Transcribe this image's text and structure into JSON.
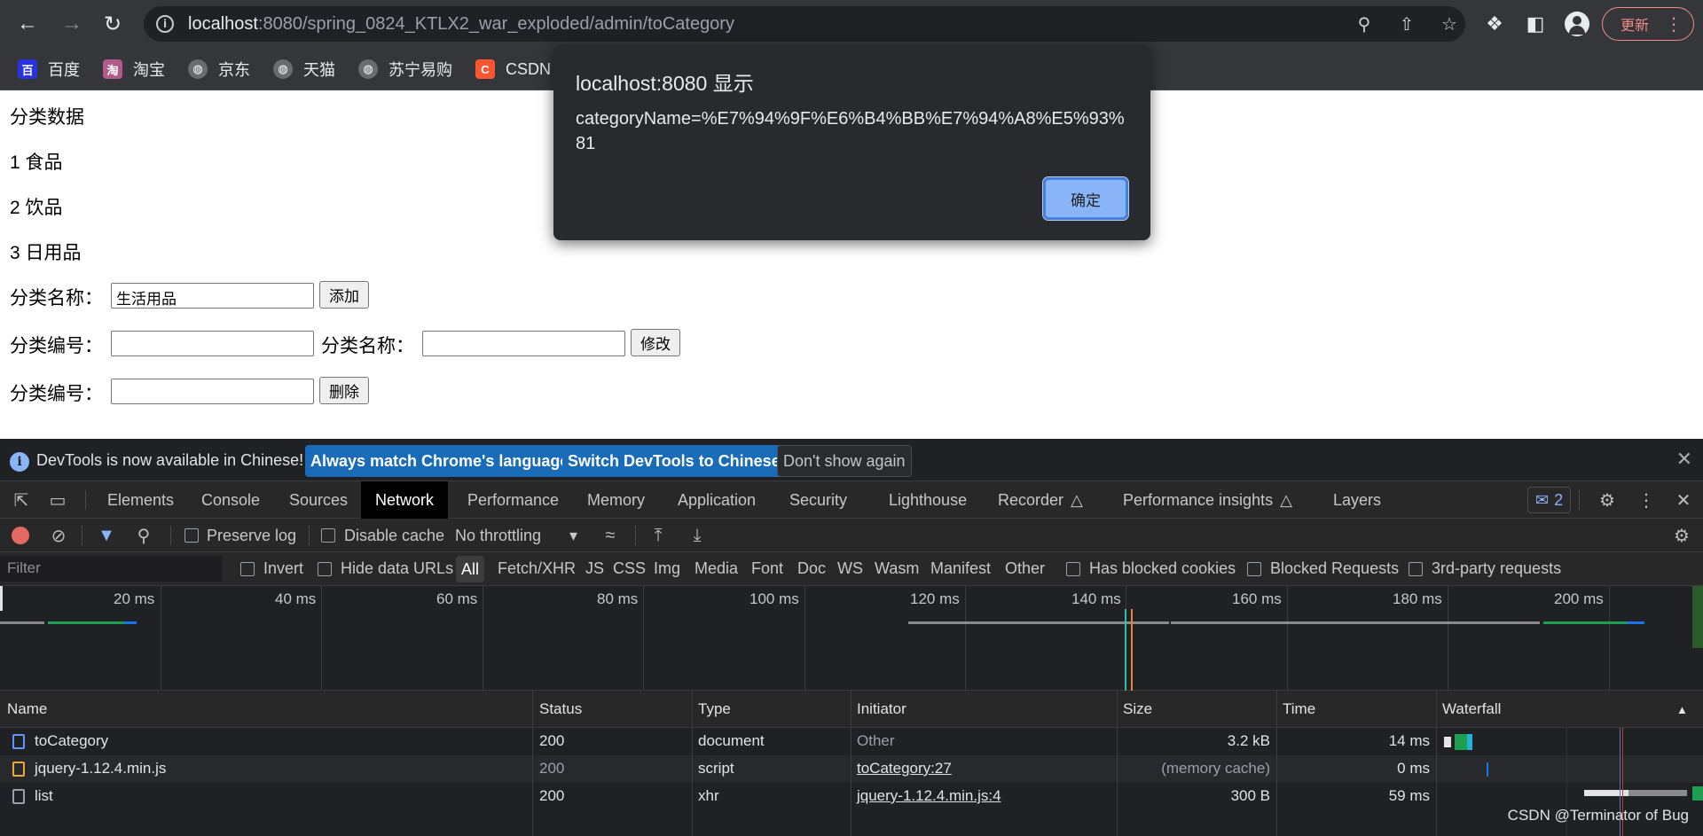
{
  "browser": {
    "url_host": "localhost",
    "url_rest": ":8080/spring_0824_KTLX2_war_exploded/admin/toCategory",
    "update_label": "更新",
    "icons": [
      "back-icon",
      "forward-icon",
      "reload-icon",
      "info-icon",
      "zoom-icon",
      "share-icon",
      "star-icon",
      "extensions-icon",
      "sidepanel-icon",
      "profile-icon",
      "menu-icon"
    ]
  },
  "bookmarks": [
    {
      "label": "百度",
      "fav": "百",
      "color": "#2932e1"
    },
    {
      "label": "淘宝",
      "fav": "淘",
      "color": "#b05a8a"
    },
    {
      "label": "京东",
      "fav": "◍",
      "color": "#6b6c70"
    },
    {
      "label": "天猫",
      "fav": "◍",
      "color": "#6b6c70"
    },
    {
      "label": "苏宁易购",
      "fav": "◍",
      "color": "#6b6c70"
    },
    {
      "label": "CSDN",
      "fav": "C",
      "color": "#fc5531"
    }
  ],
  "content": {
    "heading": "分类数据",
    "items": [
      "1 食品",
      "2 饮品",
      "3 日用品"
    ],
    "add_label": "分类名称：",
    "add_value": "生活用品",
    "add_button": "添加",
    "edit_id_label": "分类编号：",
    "edit_name_label": "分类名称：",
    "edit_button": "修改",
    "delete_label": "分类编号：",
    "delete_button": "删除"
  },
  "alert": {
    "title": "localhost:8080 显示",
    "message": "categoryName=%E7%94%9F%E6%B4%BB%E7%94%A8%E5%93%81",
    "ok_label": "确定"
  },
  "devtools": {
    "infobar": {
      "text": "DevTools is now available in Chinese!",
      "btn_match": "Always match Chrome's language",
      "btn_switch": "Switch DevTools to Chinese",
      "btn_dismiss": "Don't show again"
    },
    "tabs": [
      "Elements",
      "Console",
      "Sources",
      "Network",
      "Performance",
      "Memory",
      "Application",
      "Security",
      "Lighthouse",
      "Recorder",
      "Performance insights",
      "Layers"
    ],
    "active_tab": "Network",
    "issues_count": "2",
    "toolbar": {
      "preserve_log": "Preserve log",
      "disable_cache": "Disable cache",
      "throttling": "No throttling"
    },
    "filter": {
      "placeholder": "Filter",
      "invert": "Invert",
      "hide_data_urls": "Hide data URLs",
      "types": [
        "All",
        "Fetch/XHR",
        "JS",
        "CSS",
        "Img",
        "Media",
        "Font",
        "Doc",
        "WS",
        "Wasm",
        "Manifest",
        "Other"
      ],
      "blocked_cookies": "Has blocked cookies",
      "blocked_requests": "Blocked Requests",
      "third_party": "3rd-party requests"
    },
    "timeline_ticks": [
      "20 ms",
      "40 ms",
      "60 ms",
      "80 ms",
      "100 ms",
      "120 ms",
      "140 ms",
      "160 ms",
      "180 ms",
      "200 ms"
    ],
    "columns": [
      "Name",
      "Status",
      "Type",
      "Initiator",
      "Size",
      "Time",
      "Waterfall"
    ],
    "rows": [
      {
        "name": "toCategory",
        "status": "200",
        "type": "document",
        "initiator": "Other",
        "size": "3.2 kB",
        "time": "14 ms"
      },
      {
        "name": "jquery-1.12.4.min.js",
        "status": "200",
        "type": "script",
        "initiator": "toCategory:27",
        "size": "(memory cache)",
        "time": "0 ms"
      },
      {
        "name": "list",
        "status": "200",
        "type": "xhr",
        "initiator": "jquery-1.12.4.min.js:4",
        "size": "300 B",
        "time": "59 ms"
      }
    ]
  },
  "watermark": "CSDN @Terminator of Bug"
}
